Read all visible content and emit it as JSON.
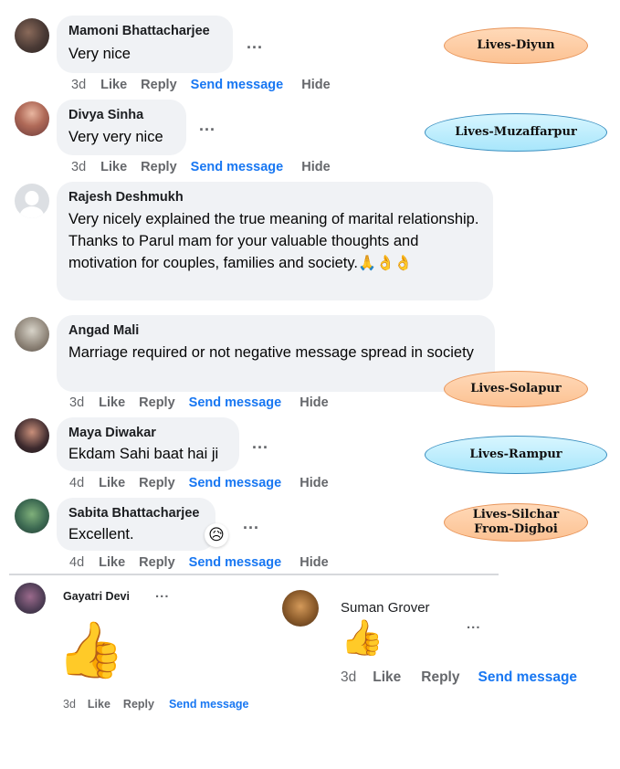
{
  "comments": [
    {
      "name": "Mamoni Bhattacharjee",
      "text": "Very nice",
      "time": "3d",
      "like": "Like",
      "reply": "Reply",
      "send": "Send message",
      "hide": "Hide"
    },
    {
      "name": "Divya Sinha",
      "text": "Very very nice",
      "time": "3d",
      "like": "Like",
      "reply": "Reply",
      "send": "Send message",
      "hide": "Hide"
    },
    {
      "name": "Rajesh Deshmukh",
      "text": "Very nicely explained the true meaning of marital relationship. Thanks to Parul mam for your valuable thoughts and motivation for couples, families and society.",
      "emojis": "🙏👌👌"
    },
    {
      "name": "Angad Mali",
      "text": "Marriage required or not negative message spread in society",
      "time": "3d",
      "like": "Like",
      "reply": "Reply",
      "send": "Send message",
      "hide": "Hide"
    },
    {
      "name": "Maya Diwakar",
      "text": "Ekdam Sahi baat hai ji",
      "time": "4d",
      "like": "Like",
      "reply": "Reply",
      "send": "Send message",
      "hide": "Hide"
    },
    {
      "name": "Sabita Bhattacharjee",
      "text": "Excellent.",
      "time": "4d",
      "like": "Like",
      "reply": "Reply",
      "send": "Send message",
      "hide": "Hide",
      "reaction": "😥"
    }
  ],
  "bottom_comments": [
    {
      "name": "Gayatri Devi",
      "sticker": "👍",
      "time": "3d",
      "like": "Like",
      "reply": "Reply",
      "send": "Send message"
    },
    {
      "name": "Suman Grover",
      "sticker": "👍",
      "time": "3d",
      "like": "Like",
      "reply": "Reply",
      "send": "Send message"
    }
  ],
  "more_icon": "...",
  "tags": [
    {
      "line1": "Lives-Diyun",
      "color": "orange"
    },
    {
      "line1": "Lives-Muzaffarpur",
      "color": "blue"
    },
    {
      "line1": "Lives-Solapur",
      "color": "orange"
    },
    {
      "line1": "Lives-Rampur",
      "color": "blue"
    },
    {
      "line1": "Lives-Silchar",
      "line2": "From-Digboi",
      "color": "orange"
    }
  ],
  "colors": {
    "link": "#1877f2",
    "bubble": "#f0f2f5",
    "meta": "#65676b",
    "tag_orange": "#fcc293",
    "tag_blue": "#a8e6fb"
  }
}
